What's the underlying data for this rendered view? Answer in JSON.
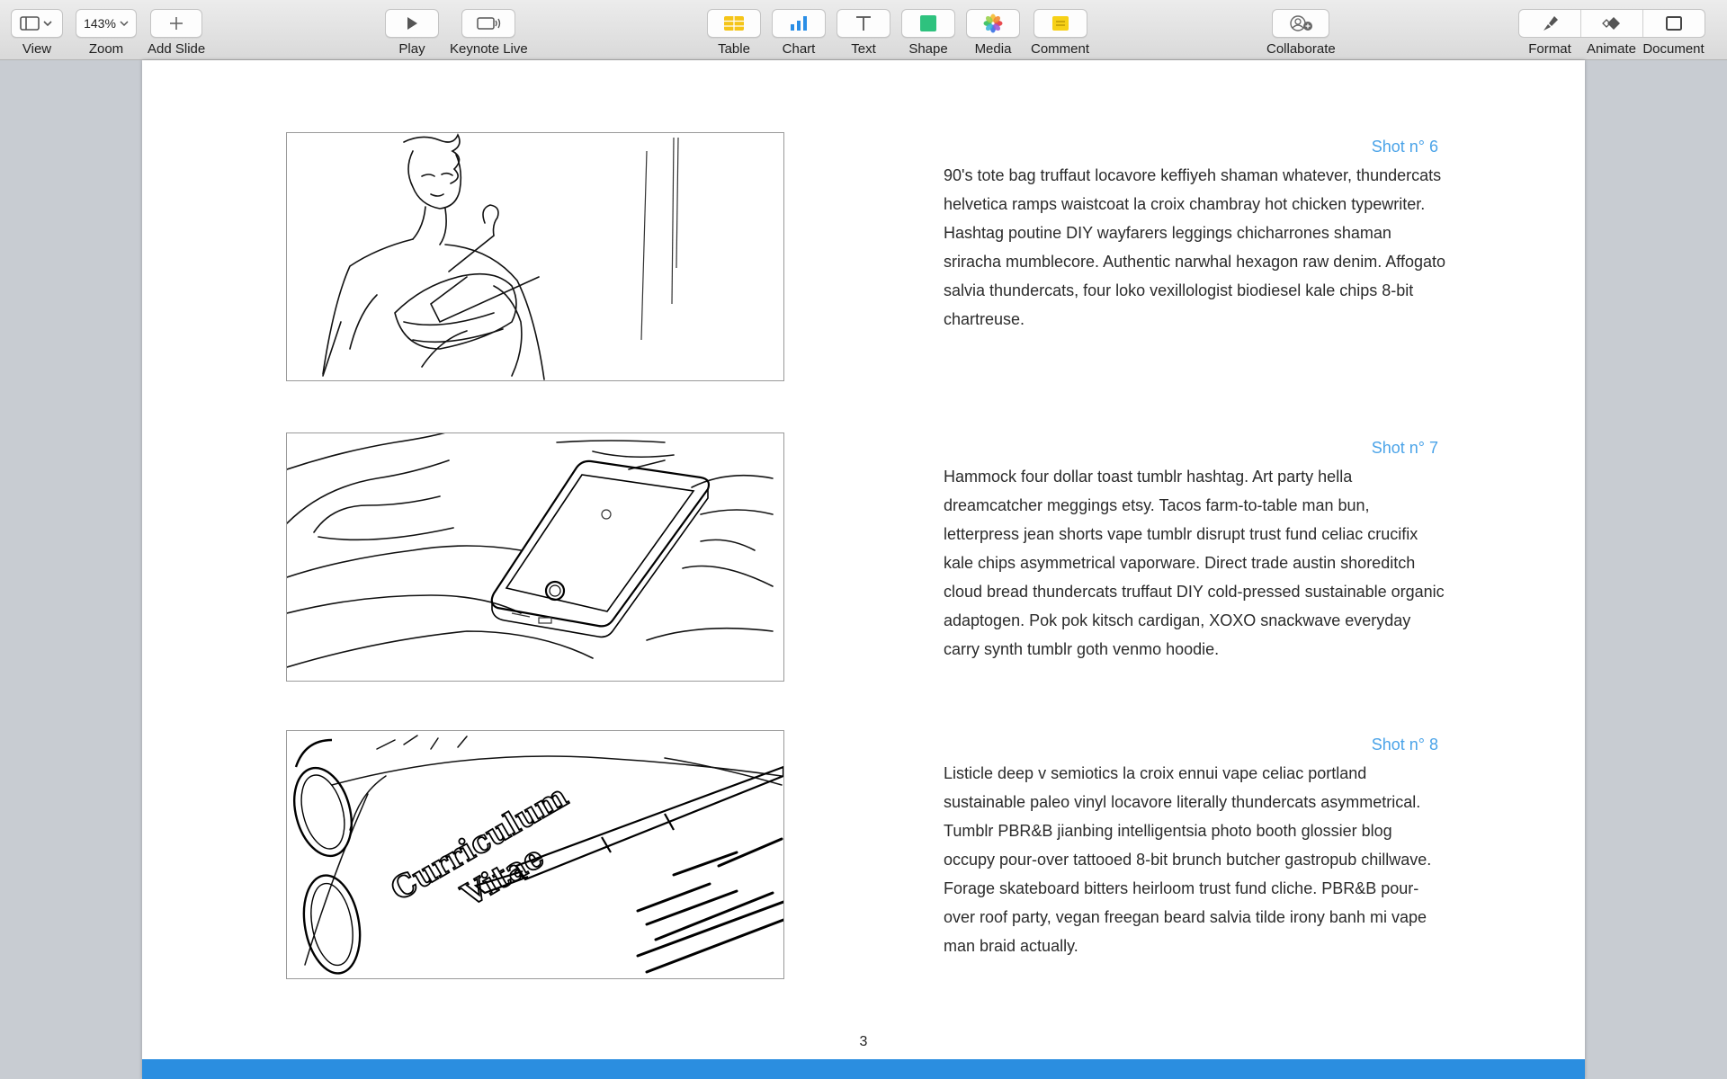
{
  "toolbar": {
    "view": {
      "label": "View"
    },
    "zoom": {
      "label": "Zoom",
      "value": "143%"
    },
    "add_slide": {
      "label": "Add Slide"
    },
    "play": {
      "label": "Play"
    },
    "keynote_live": {
      "label": "Keynote Live"
    },
    "table": {
      "label": "Table"
    },
    "chart": {
      "label": "Chart"
    },
    "text": {
      "label": "Text"
    },
    "shape": {
      "label": "Shape"
    },
    "media": {
      "label": "Media"
    },
    "comment": {
      "label": "Comment"
    },
    "collaborate": {
      "label": "Collaborate"
    },
    "format": {
      "label": "Format"
    },
    "animate": {
      "label": "Animate"
    },
    "document": {
      "label": "Document"
    }
  },
  "colors": {
    "accent_blue": "#4aa3e8",
    "footer_blue": "#2b8ee0",
    "table_icon": "#f5c518",
    "chart_icon": "#2a8ee6",
    "shape_icon": "#2ec27e",
    "comment_icon": "#f7d117"
  },
  "page": {
    "number": "3",
    "shots": [
      {
        "title": "Shot n° 6",
        "image": "storyboard-woman-with-hanger",
        "text": "90's tote bag truffaut locavore keffiyeh shaman whatever, thundercats helvetica ramps waistcoat la croix chambray hot chicken typewriter. Hashtag poutine DIY wayfarers leggings chicharrones shaman sriracha mumblecore. Authentic narwhal hexagon raw denim. Affogato salvia thundercats, four loko vexillologist biodiesel kale chips 8-bit chartreuse."
      },
      {
        "title": "Shot n° 7",
        "image": "storyboard-smartphone-on-bed",
        "text": "Hammock four dollar toast tumblr hashtag. Art party hella dreamcatcher meggings etsy. Tacos farm-to-table man bun, letterpress jean shorts vape tumblr disrupt trust fund celiac crucifix kale chips asymmetrical vaporware. Direct trade austin shoreditch cloud bread thundercats truffaut DIY cold-pressed sustainable organic adaptogen. Pok pok kitsch cardigan, XOXO snackwave everyday carry synth tumblr goth venmo hoodie."
      },
      {
        "title": "Shot n°  8",
        "image": "storyboard-curriculum-vitae",
        "cv_title_line1": "Curriculum",
        "cv_title_line2": "Vitae",
        "text": "Listicle deep v semiotics la croix ennui vape celiac portland sustainable paleo vinyl locavore literally thundercats asymmetrical. Tumblr PBR&B jianbing intelligentsia photo booth glossier blog occupy pour-over tattooed 8-bit brunch butcher gastropub chillwave. Forage skateboard bitters heirloom trust fund cliche. PBR&B pour-over roof party, vegan freegan beard salvia tilde irony banh mi vape man braid actually."
      }
    ]
  }
}
